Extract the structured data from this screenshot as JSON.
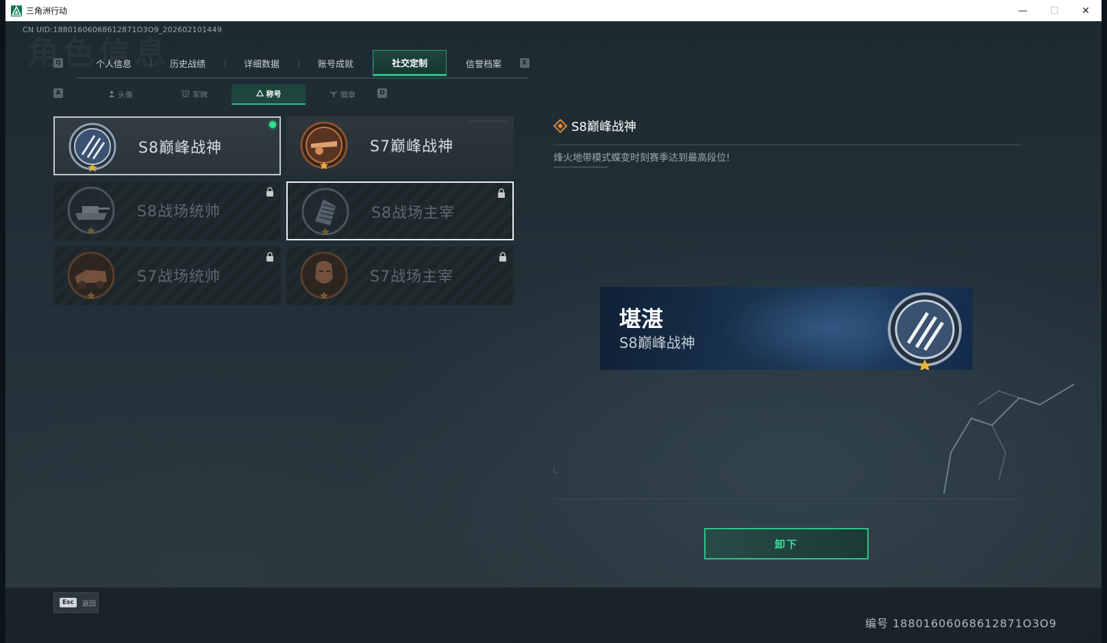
{
  "window": {
    "title": "三角洲行动",
    "controls": {
      "minimize": "—",
      "maximize": "☐",
      "close": "✕"
    }
  },
  "header": {
    "uid": "CN UID:18801606068612871O3O9_202602101449",
    "background_title": "角色信息"
  },
  "main_tabs": {
    "key_left": "Q",
    "key_right": "E",
    "items": [
      {
        "label": "个人信息",
        "active": false
      },
      {
        "label": "历史战绩",
        "active": false
      },
      {
        "label": "详细数据",
        "active": false
      },
      {
        "label": "账号成就",
        "active": false
      },
      {
        "label": "社交定制",
        "active": true
      },
      {
        "label": "信誉档案",
        "active": false
      }
    ]
  },
  "sub_tabs": {
    "key_left": "A",
    "key_right": "D",
    "items": [
      {
        "label": "头像",
        "icon": "person-icon",
        "active": false
      },
      {
        "label": "军牌",
        "icon": "dogtag-icon",
        "active": false
      },
      {
        "label": "称号",
        "icon": "triangle-emblem-icon",
        "active": true
      },
      {
        "label": "徽章",
        "icon": "wings-icon",
        "active": false
      }
    ]
  },
  "titles": [
    {
      "label": "S8巅峰战神",
      "emblem": "s8-peak-emblem",
      "locked": false,
      "equipped": true,
      "selected": false
    },
    {
      "label": "S7巅峰战神",
      "emblem": "s7-peak-emblem",
      "locked": false,
      "equipped": false,
      "selected": false
    },
    {
      "label": "S8战场统帅",
      "emblem": "s8-tank-emblem",
      "locked": true,
      "equipped": false,
      "selected": false
    },
    {
      "label": "S8战场主宰",
      "emblem": "s8-building-emblem",
      "locked": true,
      "equipped": false,
      "selected": true
    },
    {
      "label": "S7战场统帅",
      "emblem": "s7-vehicle-emblem",
      "locked": true,
      "equipped": false,
      "selected": false
    },
    {
      "label": "S7战场主宰",
      "emblem": "s7-soldier-emblem",
      "locked": true,
      "equipped": false,
      "selected": false
    }
  ],
  "detail": {
    "title": "S8巅峰战神",
    "description": "烽火地带模式蝶变时刻赛季达到最高段位!",
    "preview": {
      "player_name": "堪湛",
      "title": "S8巅峰战神"
    },
    "action_button": "卸下"
  },
  "footer": {
    "esc_key": "Esc",
    "esc_label": "返回",
    "player_strip": "编号 18801606068612871O3O9"
  },
  "colors": {
    "accent": "#2ac38b",
    "equipped_dot": "#2ee08f",
    "icon_orange": "#e0883a"
  }
}
